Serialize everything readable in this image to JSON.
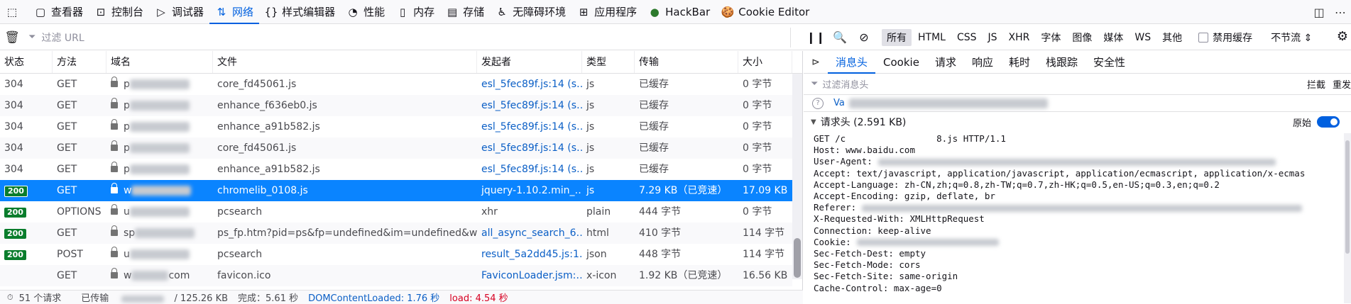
{
  "toolbar": {
    "tabs": [
      {
        "label": "查看器",
        "icon": "inspector-icon",
        "glyph": "▢"
      },
      {
        "label": "控制台",
        "icon": "console-icon",
        "glyph": "⊡"
      },
      {
        "label": "调试器",
        "icon": "debugger-icon",
        "glyph": "▷"
      },
      {
        "label": "网络",
        "icon": "network-icon",
        "glyph": "⇅"
      },
      {
        "label": "样式编辑器",
        "icon": "style-editor-icon",
        "glyph": "{}"
      },
      {
        "label": "性能",
        "icon": "performance-icon",
        "glyph": "◔"
      },
      {
        "label": "内存",
        "icon": "memory-icon",
        "glyph": "▯"
      },
      {
        "label": "存储",
        "icon": "storage-icon",
        "glyph": "▤"
      },
      {
        "label": "无障碍环境",
        "icon": "accessibility-icon",
        "glyph": "♿"
      },
      {
        "label": "应用程序",
        "icon": "application-icon",
        "glyph": "⊞"
      },
      {
        "label": "HackBar",
        "icon": "hackbar-icon",
        "glyph": "●"
      },
      {
        "label": "Cookie Editor",
        "icon": "cookie-editor-icon",
        "glyph": "🍪"
      }
    ],
    "active_tab": "网络"
  },
  "filter": {
    "placeholder": "过滤 URL",
    "types": [
      "所有",
      "HTML",
      "CSS",
      "JS",
      "XHR",
      "字体",
      "图像",
      "媒体",
      "WS",
      "其他"
    ],
    "active_type": "所有",
    "disable_cache_label": "禁用缓存",
    "throttle_label": "不节流 ⇕"
  },
  "table": {
    "columns": [
      "状态",
      "方法",
      "域名",
      "文件",
      "发起者",
      "类型",
      "传输",
      "大小"
    ],
    "rows": [
      {
        "status": "304",
        "method": "GET",
        "domain": "p",
        "file": "core_fd45061.js",
        "initiator": "esl_5fec89f.js:14 (s…",
        "type": "js",
        "transfer": "已缓存",
        "size": "0 字节"
      },
      {
        "status": "304",
        "method": "GET",
        "domain": "p",
        "file": "enhance_f636eb0.js",
        "initiator": "esl_5fec89f.js:14 (s…",
        "type": "js",
        "transfer": "已缓存",
        "size": "0 字节"
      },
      {
        "status": "304",
        "method": "GET",
        "domain": "p",
        "file": "enhance_a91b582.js",
        "initiator": "esl_5fec89f.js:14 (s…",
        "type": "js",
        "transfer": "已缓存",
        "size": "0 字节"
      },
      {
        "status": "304",
        "method": "GET",
        "domain": "p",
        "file": "core_fd45061.js",
        "initiator": "esl_5fec89f.js:14 (s…",
        "type": "js",
        "transfer": "已缓存",
        "size": "0 字节"
      },
      {
        "status": "304",
        "method": "GET",
        "domain": "p",
        "file": "enhance_a91b582.js",
        "initiator": "esl_5fec89f.js:14 (s…",
        "type": "js",
        "transfer": "已缓存",
        "size": "0 字节"
      },
      {
        "status": "200",
        "method": "GET",
        "domain": "w",
        "file": "chromelib_0108.js",
        "initiator": "jquery-1.10.2.min_…",
        "type": "js",
        "transfer": "7.29 KB（已竞速）",
        "size": "17.09 KB"
      },
      {
        "status": "200",
        "method": "OPTIONS",
        "domain": "u",
        "file": "pcsearch",
        "initiator": "xhr",
        "type": "plain",
        "transfer": "444 字节",
        "size": "0 字节"
      },
      {
        "status": "200",
        "method": "GET",
        "domain": "sp",
        "file": "ps_fp.htm?pid=ps&fp=undefined&im=undefined&wf=",
        "initiator": "all_async_search_6…",
        "type": "html",
        "transfer": "410 字节",
        "size": "114 字节"
      },
      {
        "status": "200",
        "method": "POST",
        "domain": "u",
        "file": "pcsearch",
        "initiator": "result_5a2dd45.js:1…",
        "type": "json",
        "transfer": "448 字节",
        "size": "114 字节"
      },
      {
        "status": "",
        "method": "GET",
        "domain": "w",
        "domain_tail": "com",
        "file": "favicon.ico",
        "initiator": "FaviconLoader.jsm:…",
        "type": "x-icon",
        "transfer": "1.92 KB（已竞速）",
        "size": "16.56 KB"
      }
    ],
    "selected_index": 5
  },
  "statusbar": {
    "requests": "51 个请求",
    "transferred": "已传输",
    "transferred_total": "/ 125.26 KB",
    "finish": "完成：5.61 秒",
    "dom": "DOMContentLoaded: 1.76 秒",
    "load": "load: 4.54 秒"
  },
  "details": {
    "tabs": [
      "消息头",
      "Cookie",
      "请求",
      "响应",
      "耗时",
      "栈跟踪",
      "安全性"
    ],
    "active_tab": "消息头",
    "filter_placeholder": "过滤消息头",
    "block_label": "拦截",
    "resend_label": "重发",
    "url_prefix": "Va",
    "request_headers_title": "请求头 (2.591 KB)",
    "raw_label": "原始",
    "raw_lines": [
      "GET /c                 8.js HTTP/1.1",
      "Host: www.baidu.com",
      "User-Agent:",
      "Accept: text/javascript, application/javascript, application/ecmascript, application/x-ecmas",
      "Accept-Language: zh-CN,zh;q=0.8,zh-TW;q=0.7,zh-HK;q=0.5,en-US;q=0.3,en;q=0.2",
      "Accept-Encoding: gzip, deflate, br",
      "Referer:",
      "X-Requested-With: XMLHttpRequest",
      "Connection: keep-alive",
      "Cookie:",
      "Sec-Fetch-Dest: empty",
      "Sec-Fetch-Mode: cors",
      "Sec-Fetch-Site: same-origin",
      "Cache-Control: max-age=0"
    ]
  }
}
